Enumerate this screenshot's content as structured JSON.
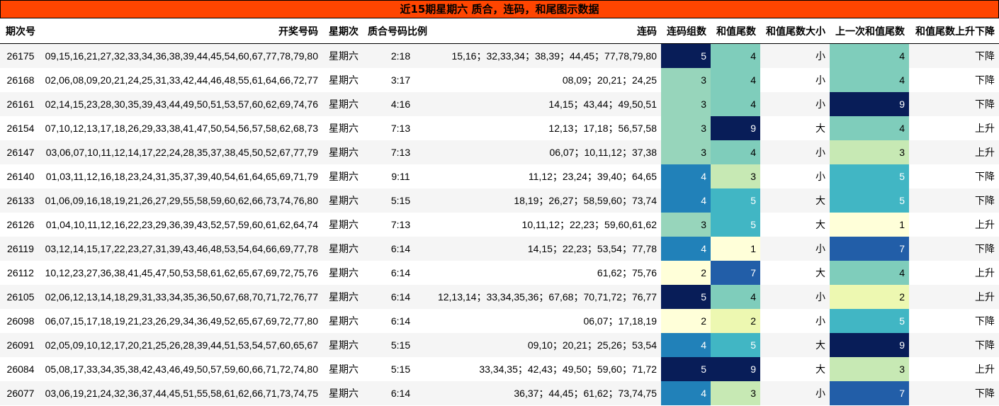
{
  "title": "近15期星期六 质合，连码，和尾图示数据",
  "columns": [
    "期次号",
    "开奖号码",
    "星期次",
    "质合号码比例",
    "连码",
    "连码组数",
    "和值尾数",
    "和值尾数大小",
    "上一次和值尾数",
    "和值尾数上升下降"
  ],
  "rows": [
    {
      "issue": "26175",
      "numbers": "09,15,16,21,27,32,33,34,36,38,39,44,45,54,60,67,77,78,79,80",
      "weekday": "星期六",
      "ratio": "2:18",
      "consec": "15,16；32,33,34；38,39；44,45；77,78,79,80",
      "groups": "5",
      "tail": "4",
      "size": "小",
      "prev_tail": "4",
      "trend": "下降"
    },
    {
      "issue": "26168",
      "numbers": "02,06,08,09,20,21,24,25,31,33,42,44,46,48,55,61,64,66,72,77",
      "weekday": "星期六",
      "ratio": "3:17",
      "consec": "08,09；20,21；24,25",
      "groups": "3",
      "tail": "4",
      "size": "小",
      "prev_tail": "4",
      "trend": "下降"
    },
    {
      "issue": "26161",
      "numbers": "02,14,15,23,28,30,35,39,43,44,49,50,51,53,57,60,62,69,74,76",
      "weekday": "星期六",
      "ratio": "4:16",
      "consec": "14,15；43,44；49,50,51",
      "groups": "3",
      "tail": "4",
      "size": "小",
      "prev_tail": "9",
      "trend": "下降"
    },
    {
      "issue": "26154",
      "numbers": "07,10,12,13,17,18,26,29,33,38,41,47,50,54,56,57,58,62,68,73",
      "weekday": "星期六",
      "ratio": "7:13",
      "consec": "12,13；17,18；56,57,58",
      "groups": "3",
      "tail": "9",
      "size": "大",
      "prev_tail": "4",
      "trend": "上升"
    },
    {
      "issue": "26147",
      "numbers": "03,06,07,10,11,12,14,17,22,24,28,35,37,38,45,50,52,67,77,79",
      "weekday": "星期六",
      "ratio": "7:13",
      "consec": "06,07；10,11,12；37,38",
      "groups": "3",
      "tail": "4",
      "size": "小",
      "prev_tail": "3",
      "trend": "上升"
    },
    {
      "issue": "26140",
      "numbers": "01,03,11,12,16,18,23,24,31,35,37,39,40,54,61,64,65,69,71,79",
      "weekday": "星期六",
      "ratio": "9:11",
      "consec": "11,12；23,24；39,40；64,65",
      "groups": "4",
      "tail": "3",
      "size": "小",
      "prev_tail": "5",
      "trend": "下降"
    },
    {
      "issue": "26133",
      "numbers": "01,06,09,16,18,19,21,26,27,29,55,58,59,60,62,66,73,74,76,80",
      "weekday": "星期六",
      "ratio": "5:15",
      "consec": "18,19；26,27；58,59,60；73,74",
      "groups": "4",
      "tail": "5",
      "size": "大",
      "prev_tail": "5",
      "trend": "下降"
    },
    {
      "issue": "26126",
      "numbers": "01,04,10,11,12,16,22,23,29,36,39,43,52,57,59,60,61,62,64,74",
      "weekday": "星期六",
      "ratio": "7:13",
      "consec": "10,11,12；22,23；59,60,61,62",
      "groups": "3",
      "tail": "5",
      "size": "大",
      "prev_tail": "1",
      "trend": "上升"
    },
    {
      "issue": "26119",
      "numbers": "03,12,14,15,17,22,23,27,31,39,43,46,48,53,54,64,66,69,77,78",
      "weekday": "星期六",
      "ratio": "6:14",
      "consec": "14,15；22,23；53,54；77,78",
      "groups": "4",
      "tail": "1",
      "size": "小",
      "prev_tail": "7",
      "trend": "下降"
    },
    {
      "issue": "26112",
      "numbers": "10,12,23,27,36,38,41,45,47,50,53,58,61,62,65,67,69,72,75,76",
      "weekday": "星期六",
      "ratio": "6:14",
      "consec": "61,62；75,76",
      "groups": "2",
      "tail": "7",
      "size": "大",
      "prev_tail": "4",
      "trend": "上升"
    },
    {
      "issue": "26105",
      "numbers": "02,06,12,13,14,18,29,31,33,34,35,36,50,67,68,70,71,72,76,77",
      "weekday": "星期六",
      "ratio": "6:14",
      "consec": "12,13,14；33,34,35,36；67,68；70,71,72；76,77",
      "groups": "5",
      "tail": "4",
      "size": "小",
      "prev_tail": "2",
      "trend": "上升"
    },
    {
      "issue": "26098",
      "numbers": "06,07,15,17,18,19,21,23,26,29,34,36,49,52,65,67,69,72,77,80",
      "weekday": "星期六",
      "ratio": "6:14",
      "consec": "06,07；17,18,19",
      "groups": "2",
      "tail": "2",
      "size": "小",
      "prev_tail": "5",
      "trend": "下降"
    },
    {
      "issue": "26091",
      "numbers": "02,05,09,10,12,17,20,21,25,26,28,39,44,51,53,54,57,60,65,67",
      "weekday": "星期六",
      "ratio": "5:15",
      "consec": "09,10；20,21；25,26；53,54",
      "groups": "4",
      "tail": "5",
      "size": "大",
      "prev_tail": "9",
      "trend": "下降"
    },
    {
      "issue": "26084",
      "numbers": "05,08,17,33,34,35,38,42,43,46,49,50,57,59,60,66,71,72,74,80",
      "weekday": "星期六",
      "ratio": "5:15",
      "consec": "33,34,35；42,43；49,50；59,60；71,72",
      "groups": "5",
      "tail": "9",
      "size": "大",
      "prev_tail": "3",
      "trend": "上升"
    },
    {
      "issue": "26077",
      "numbers": "03,06,19,21,24,32,36,37,44,45,51,55,58,61,62,66,71,73,74,75",
      "weekday": "星期六",
      "ratio": "6:14",
      "consec": "36,37；44,45；61,62；73,74,75",
      "groups": "4",
      "tail": "3",
      "size": "小",
      "prev_tail": "7",
      "trend": "下降"
    }
  ],
  "heat_colors": {
    "1": "#ffffd9",
    "2": "#ffffd9",
    "3": "#c7e9b4",
    "4": "#7fcdbb",
    "5": "#41b6c4",
    "7": "#225ea8",
    "9": "#081d58"
  },
  "groups_colors": {
    "2": "#ffffd9",
    "3": "#97d5bb",
    "4": "#2181b9",
    "5": "#081d58"
  },
  "tail_colors": {
    "1": "#ffffd9",
    "2": "#edf8b1",
    "3": "#c7e9b4",
    "4": "#7fcdbb",
    "5": "#41b6c4",
    "7": "#225ea8",
    "9": "#081d58"
  },
  "prev_tail_colors": {
    "1": "#ffffd9",
    "2": "#edf8b1",
    "3": "#c7e9b4",
    "4": "#7fcdbb",
    "5": "#41b6c4",
    "7": "#225ea8",
    "9": "#081d58"
  }
}
